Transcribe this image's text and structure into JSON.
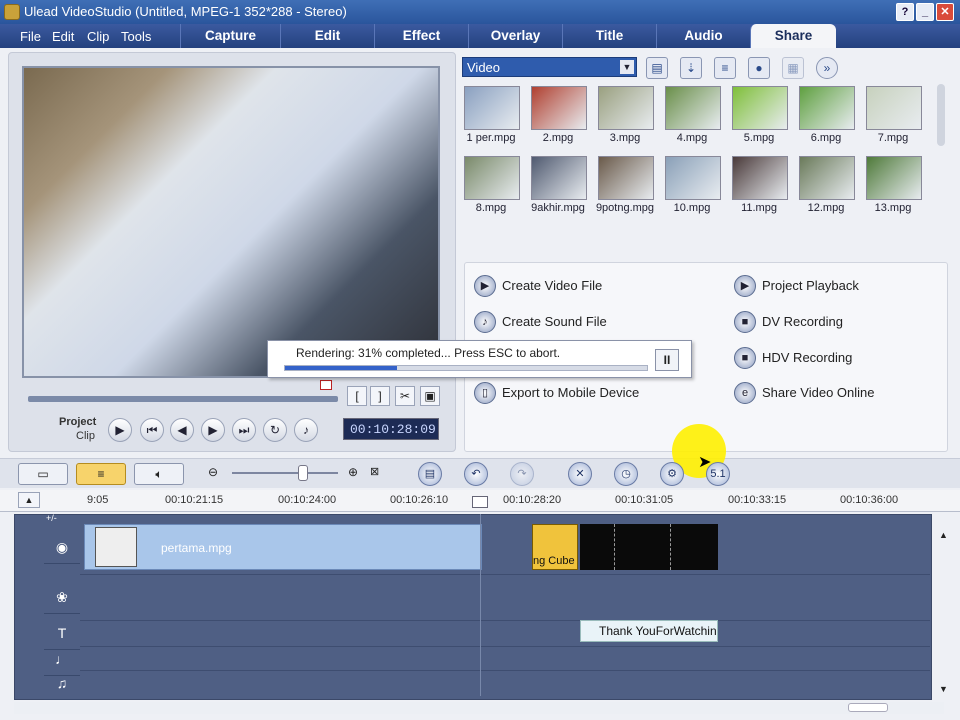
{
  "window": {
    "title": "Ulead VideoStudio (Untitled, MPEG-1 352*288 - Stereo)"
  },
  "menu": [
    "File",
    "Edit",
    "Clip",
    "Tools"
  ],
  "tabs": [
    "Capture",
    "Edit",
    "Effect",
    "Overlay",
    "Title",
    "Audio",
    "Share"
  ],
  "active_tab": "Share",
  "preview": {
    "mode_project": "Project",
    "mode_clip": "Clip",
    "timecode": "00:10:28:09"
  },
  "library": {
    "category": "Video",
    "thumbs": [
      "1 per.mpg",
      "2.mpg",
      "3.mpg",
      "4.mpg",
      "5.mpg",
      "6.mpg",
      "7.mpg",
      "8.mpg",
      "9akhir.mpg",
      "9potng.mpg",
      "10.mpg",
      "11.mpg",
      "12.mpg",
      "13.mpg"
    ]
  },
  "share": {
    "left": [
      "Create Video File",
      "Create Sound File",
      "",
      "Export to Mobile Device"
    ],
    "right": [
      "Project Playback",
      "DV Recording",
      "HDV Recording",
      "Share Video Online"
    ]
  },
  "render": {
    "message": "Rendering: 31% completed... Press ESC to abort.",
    "progress": 0.31,
    "pause": "II"
  },
  "ruler": [
    "9:05",
    "00:10:21:15",
    "00:10:24:00",
    "00:10:26:10",
    "00:10:28:20",
    "00:10:31:05",
    "00:10:33:15",
    "00:10:36:00"
  ],
  "timeline": {
    "clip_name": "pertama.mpg",
    "transition": "ng Cube",
    "title_text": "Thank YouForWatching",
    "zoom_label": "+/-"
  },
  "colors": {
    "accent": "#2a559c",
    "highlight": "#fff200"
  }
}
